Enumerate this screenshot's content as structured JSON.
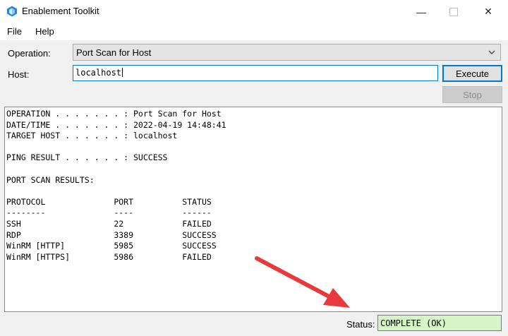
{
  "window": {
    "title": "Enablement Toolkit",
    "controls": {
      "minimize": "—",
      "close": "✕"
    }
  },
  "menu": {
    "file": "File",
    "help": "Help"
  },
  "form": {
    "operation_label": "Operation:",
    "operation_value": "Port Scan for Host",
    "host_label": "Host:",
    "host_value": "localhost"
  },
  "buttons": {
    "execute": "Execute",
    "stop": "Stop"
  },
  "output": {
    "lines": [
      "OPERATION . . . . . . . : Port Scan for Host",
      "DATE/TIME . . . . . . . : 2022-04-19 14:48:41",
      "TARGET HOST . . . . . . : localhost",
      "",
      "PING RESULT . . . . . . : SUCCESS",
      "",
      "PORT SCAN RESULTS:",
      "",
      "PROTOCOL              PORT          STATUS",
      "--------              ----          ------",
      "SSH                   22            FAILED",
      "RDP                   3389          SUCCESS",
      "WinRM [HTTP]          5985          SUCCESS",
      "WinRM [HTTPS]         5986          FAILED"
    ]
  },
  "status": {
    "label": "Status:",
    "value": "COMPLETE (OK)"
  },
  "colors": {
    "accent": "#0078d7",
    "status_ok_bg": "#d6f5c6",
    "annotation_arrow": "#e8393c"
  }
}
